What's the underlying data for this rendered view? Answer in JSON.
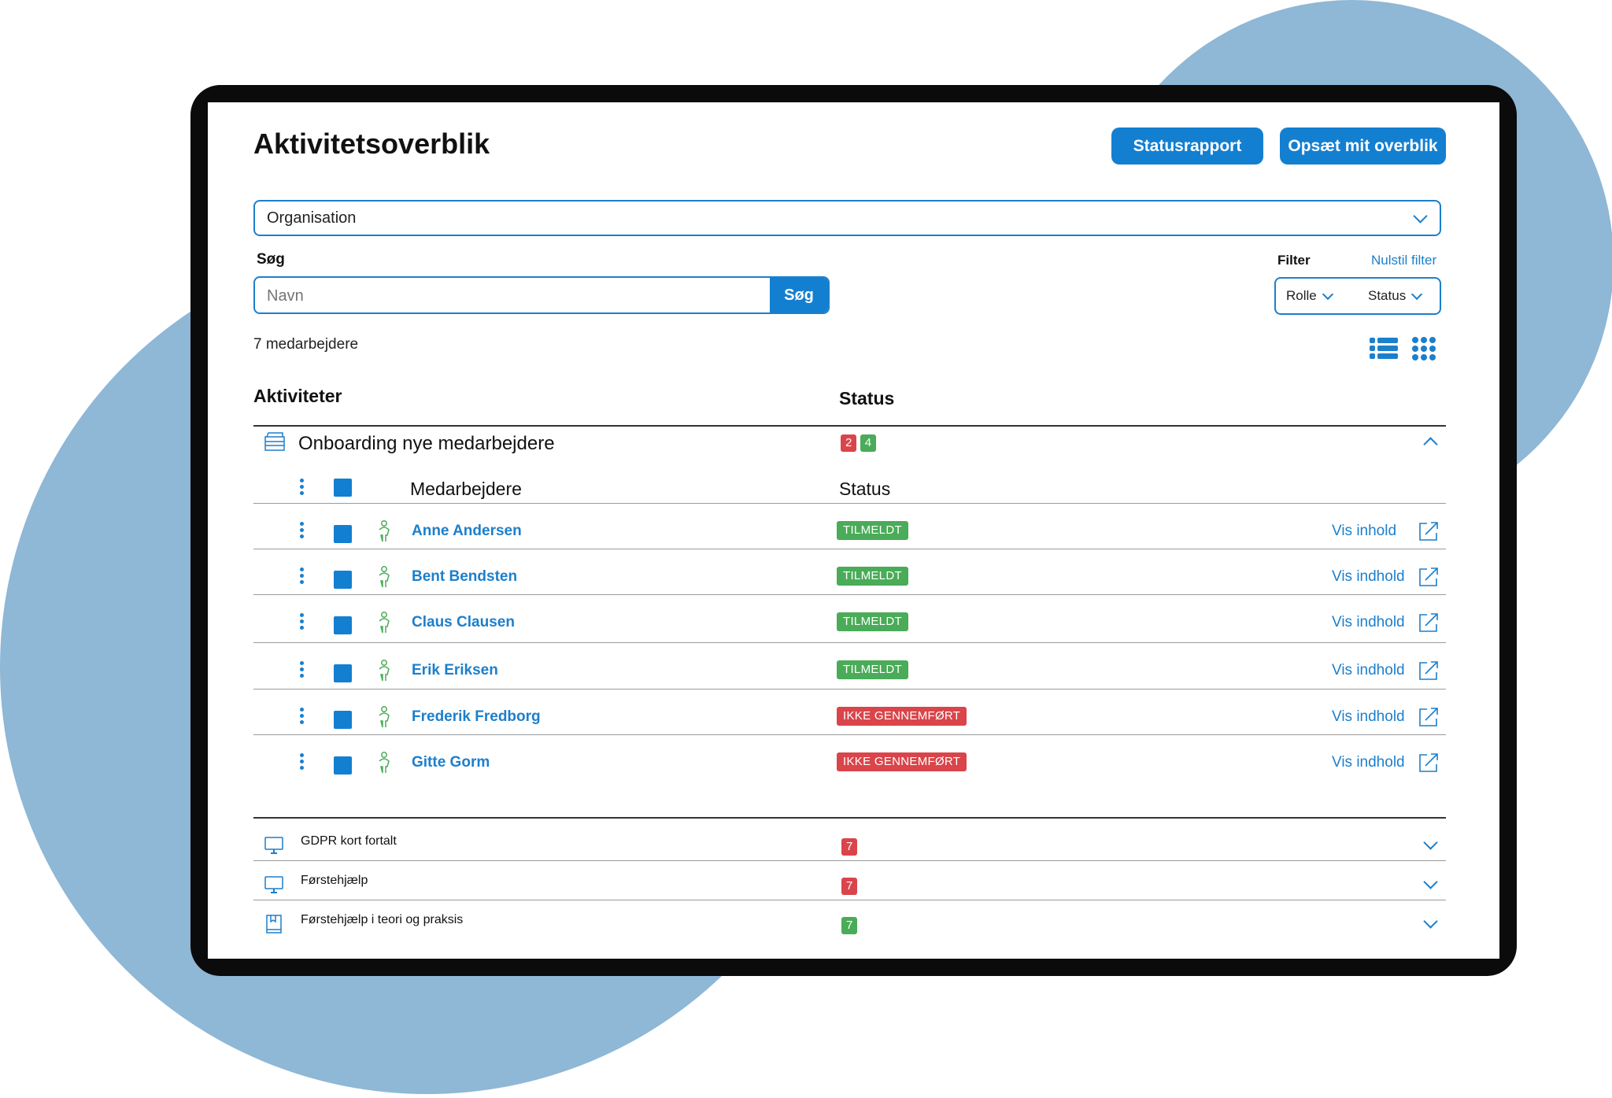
{
  "header": {
    "title": "Aktivitetsoverblik",
    "statusrapport_label": "Statusrapport",
    "setup_label": "Opsæt mit overblik"
  },
  "organisation": {
    "value": "Organisation"
  },
  "search": {
    "label": "Søg",
    "placeholder": "Navn",
    "button_label": "Søg"
  },
  "filter": {
    "label": "Filter",
    "reset_label": "Nulstil filter",
    "role_label": "Rolle",
    "status_label": "Status"
  },
  "employee_count": "7 medarbejdere",
  "table": {
    "col_activities": "Aktiviteter",
    "col_status": "Status"
  },
  "activity": {
    "name": "Onboarding nye medarbejdere",
    "badge_red": "2",
    "badge_green": "4",
    "sub_col_employees": "Medarbejdere",
    "sub_col_status": "Status",
    "employees": [
      {
        "name": "Anne Andersen",
        "status": "TILMELDT",
        "status_color": "#4aab58",
        "action": "Vis inhold"
      },
      {
        "name": "Bent Bendsten",
        "status": "TILMELDT",
        "status_color": "#4aab58",
        "action": "Vis indhold"
      },
      {
        "name": "Claus Clausen",
        "status": "TILMELDT",
        "status_color": "#4aab58",
        "action": "Vis indhold"
      },
      {
        "name": "Erik Eriksen",
        "status": "TILMELDT",
        "status_color": "#4aab58",
        "action": "Vis indhold"
      },
      {
        "name": "Frederik Fredborg",
        "status": "IKKE GENNEMFØRT",
        "status_color": "#d9454a",
        "action": "Vis indhold"
      },
      {
        "name": "Gitte Gorm",
        "status": "IKKE GENNEMFØRT",
        "status_color": "#d9454a",
        "action": "Vis indhold"
      }
    ]
  },
  "courses": [
    {
      "name": "GDPR kort fortalt",
      "badge": "7",
      "badge_color": "#d9454a",
      "icon": "monitor-icon"
    },
    {
      "name": "Førstehjælp",
      "badge": "7",
      "badge_color": "#d9454a",
      "icon": "monitor-icon"
    },
    {
      "name": "Førstehjælp i teori og praksis",
      "badge": "7",
      "badge_color": "#4aab58",
      "icon": "book-icon"
    }
  ],
  "colors": {
    "accent": "#137fd1",
    "background_blob": "#8fb7d6",
    "success": "#4aab58",
    "danger": "#d9454a"
  }
}
